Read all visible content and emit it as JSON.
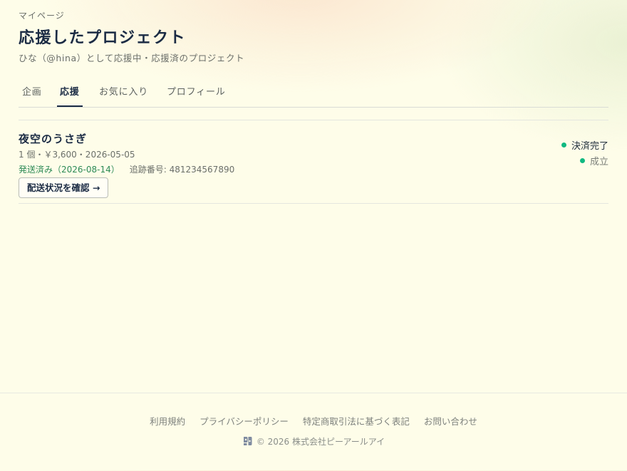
{
  "header": {
    "eyebrow": "マイページ",
    "title": "応援したプロジェクト",
    "subtitle": "ひな（@hina）として応援中・応援済のプロジェクト"
  },
  "tabs": [
    {
      "label": "企画",
      "active": false
    },
    {
      "label": "応援",
      "active": true
    },
    {
      "label": "お気に入り",
      "active": false
    },
    {
      "label": "プロフィール",
      "active": false
    }
  ],
  "pledges": [
    {
      "project_title": "夜空のうさぎ",
      "meta": "1 個・￥3,600・2026-05-05",
      "shipping_status": "発送済み（2026-08-14）",
      "tracking": "追跡番号: 481234567890",
      "track_button_label": "配送状況を確認 →",
      "payment_status": "決済完了",
      "project_status": "成立"
    }
  ],
  "footer": {
    "links": [
      "利用規約",
      "プライバシーポリシー",
      "特定商取引法に基づく表記",
      "お問い合わせ"
    ],
    "copyright": "© 2026 株式会社ピーアールアイ",
    "logo_icon": "brand-logo-icon"
  },
  "colors": {
    "accent": "#1b2b44",
    "success_dot": "#10b981",
    "shipped_text": "#2e8b57"
  }
}
